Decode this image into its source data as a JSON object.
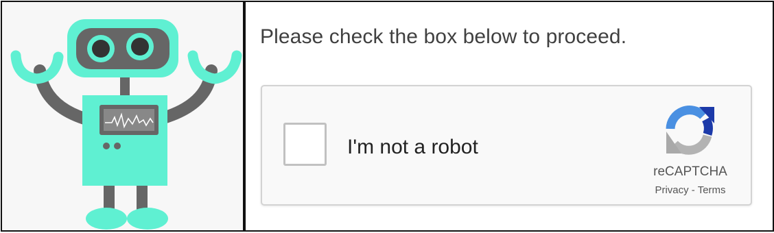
{
  "prompt": {
    "text": "Please check the box below to proceed."
  },
  "captcha": {
    "checkbox_label": "I'm not a robot",
    "checked": false,
    "brand": "reCAPTCHA",
    "privacy_link": "Privacy",
    "separator": " - ",
    "terms_link": "Terms"
  },
  "illustration": {
    "subject": "robot-mascot-icon"
  },
  "colors": {
    "robot_body": "#5ff0d2",
    "robot_limbs": "#666666",
    "panel_border": "#111111",
    "widget_border": "#d3d3d3",
    "widget_background": "#f9f9f9",
    "checkbox_border": "#c1c1c1",
    "recaptcha_blue": "#4a90e2",
    "recaptcha_dark_blue": "#1c3aa9",
    "recaptcha_gray": "#b3b3b3"
  }
}
